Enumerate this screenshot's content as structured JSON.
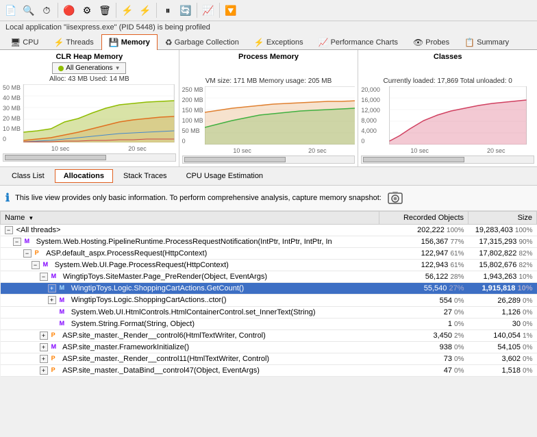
{
  "toolbar": {
    "buttons": [
      "📄",
      "🔍",
      "⏱",
      "📊",
      "⚙",
      "🗑",
      "⚡",
      "⚡",
      "⏸",
      "🔄",
      "📈",
      "🔽"
    ]
  },
  "status": {
    "text": "Local application \"iisexpress.exe\" (PID 5448) is being profiled"
  },
  "nav": {
    "tabs": [
      {
        "id": "cpu",
        "label": "CPU",
        "icon": "🖥",
        "active": false
      },
      {
        "id": "threads",
        "label": "Threads",
        "icon": "⚡",
        "active": false
      },
      {
        "id": "memory",
        "label": "Memory",
        "icon": "💾",
        "active": true
      },
      {
        "id": "gc",
        "label": "Garbage Collection",
        "icon": "♻",
        "active": false
      },
      {
        "id": "exceptions",
        "label": "Exceptions",
        "icon": "⚡",
        "active": false
      },
      {
        "id": "perf",
        "label": "Performance Charts",
        "icon": "📈",
        "active": false
      },
      {
        "id": "probes",
        "label": "Probes",
        "icon": "👁",
        "active": false
      },
      {
        "id": "summary",
        "label": "Summary",
        "icon": "📋",
        "active": false
      }
    ]
  },
  "charts": {
    "heap": {
      "title": "CLR Heap Memory",
      "gen_label": "All Generations",
      "stats": "Alloc: 43 MB   Used: 14 MB"
    },
    "process": {
      "title": "Process Memory",
      "stats": "VM size: 171 MB   Memory usage: 205 MB"
    },
    "classes": {
      "title": "Classes",
      "stats": "Currently loaded: 17,869   Total unloaded: 0"
    }
  },
  "sub_tabs": {
    "items": [
      {
        "label": "Class List",
        "active": false
      },
      {
        "label": "Allocations",
        "active": true
      },
      {
        "label": "Stack Traces",
        "active": false
      },
      {
        "label": "CPU Usage Estimation",
        "active": false
      }
    ]
  },
  "info": {
    "text": "This live view provides only basic information. To perform comprehensive analysis, capture memory snapshot:"
  },
  "table": {
    "columns": [
      "Name",
      "Recorded Objects",
      "Size"
    ],
    "rows": [
      {
        "indent": 0,
        "expand": true,
        "collapsed": false,
        "icon": "",
        "name": "<All threads>",
        "objects": "202,222",
        "obj_pct": "100%",
        "size": "19,283,403",
        "size_pct": "100%",
        "selected": false
      },
      {
        "indent": 1,
        "expand": true,
        "collapsed": false,
        "icon": "M",
        "name": "System.Web.Hosting.PipelineRuntime.ProcessRequestNotification(IntPtr, IntPtr, IntPtr, In",
        "objects": "156,367",
        "obj_pct": "77%",
        "size": "17,315,293",
        "size_pct": "90%",
        "selected": false
      },
      {
        "indent": 2,
        "expand": true,
        "collapsed": false,
        "icon": "P",
        "name": "ASP.default_aspx.ProcessRequest(HttpContext)",
        "objects": "122,947",
        "obj_pct": "61%",
        "size": "17,802,822",
        "size_pct": "82%",
        "selected": false
      },
      {
        "indent": 3,
        "expand": true,
        "collapsed": false,
        "icon": "M",
        "name": "System.Web.UI.Page.ProcessRequest(HttpContext)",
        "objects": "122,943",
        "obj_pct": "61%",
        "size": "15,802,676",
        "size_pct": "82%",
        "selected": false
      },
      {
        "indent": 4,
        "expand": true,
        "collapsed": false,
        "icon": "M",
        "name": "WingtipToys.SiteMaster.Page_PreRender(Object, EventArgs)",
        "objects": "56,122",
        "obj_pct": "28%",
        "size": "1,943,263",
        "size_pct": "10%",
        "selected": false
      },
      {
        "indent": 5,
        "expand": true,
        "collapsed": false,
        "icon": "M",
        "name": "WingtipToys.Logic.ShoppingCartActions.GetCount()",
        "objects": "55,540",
        "obj_pct": "27%",
        "size": "1,915,818",
        "size_pct": "10%",
        "selected": true
      },
      {
        "indent": 5,
        "expand": true,
        "collapsed": false,
        "icon": "M",
        "name": "WingtipToys.Logic.ShoppingCartActions..ctor()",
        "objects": "554",
        "obj_pct": "0%",
        "size": "26,289",
        "size_pct": "0%",
        "selected": false
      },
      {
        "indent": 5,
        "expand": false,
        "collapsed": false,
        "icon": "M",
        "name": "System.Web.UI.HtmlControls.HtmlContainerControl.set_InnerText(String)",
        "objects": "27",
        "obj_pct": "0%",
        "size": "1,126",
        "size_pct": "0%",
        "selected": false
      },
      {
        "indent": 5,
        "expand": false,
        "collapsed": false,
        "icon": "M",
        "name": "System.String.Format(String, Object)",
        "objects": "1",
        "obj_pct": "0%",
        "size": "30",
        "size_pct": "0%",
        "selected": false
      },
      {
        "indent": 4,
        "expand": true,
        "collapsed": false,
        "icon": "P",
        "name": "ASP.site_master._Render__control6(HtmlTextWriter, Control)",
        "objects": "3,450",
        "obj_pct": "2%",
        "size": "140,054",
        "size_pct": "1%",
        "selected": false
      },
      {
        "indent": 4,
        "expand": true,
        "collapsed": false,
        "icon": "M",
        "name": "ASP.site_master.FrameworkInitialize()",
        "objects": "938",
        "obj_pct": "0%",
        "size": "54,105",
        "size_pct": "0%",
        "selected": false
      },
      {
        "indent": 4,
        "expand": true,
        "collapsed": false,
        "icon": "P",
        "name": "ASP.site_master._Render__control11(HtmlTextWriter, Control)",
        "objects": "73",
        "obj_pct": "0%",
        "size": "3,602",
        "size_pct": "0%",
        "selected": false
      },
      {
        "indent": 4,
        "expand": true,
        "collapsed": false,
        "icon": "P",
        "name": "ASP.site_master._DataBind__control47(Object, EventArgs)",
        "objects": "47",
        "obj_pct": "0%",
        "size": "1,518",
        "size_pct": "0%",
        "selected": false
      }
    ]
  },
  "time_labels": [
    "10 sec",
    "20 sec"
  ],
  "mb_labels_heap": [
    "50 MB",
    "40 MB",
    "30 MB",
    "20 MB",
    "10 MB",
    "0"
  ],
  "mb_labels_process": [
    "250 MB",
    "200 MB",
    "150 MB",
    "100 MB",
    "50 MB",
    "0"
  ],
  "mb_labels_classes": [
    "20,000",
    "16,000",
    "12,000",
    "8,000",
    "4,000",
    "0"
  ]
}
